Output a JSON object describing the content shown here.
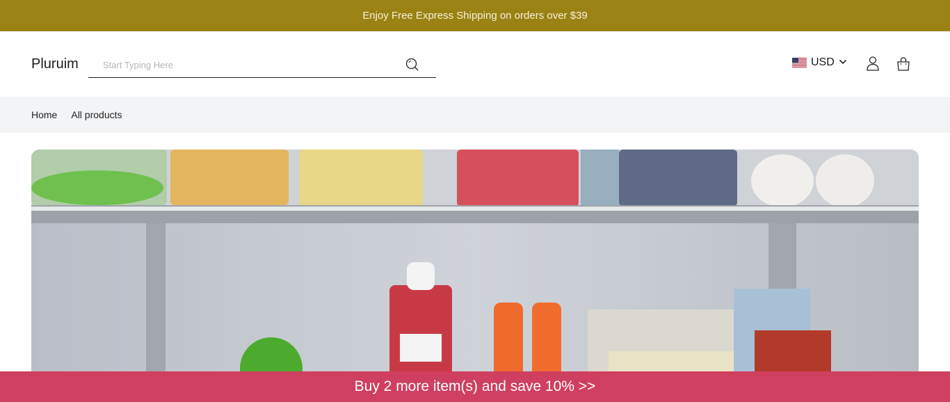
{
  "announcement": {
    "text": "Enjoy Free Express Shipping on orders over $39"
  },
  "header": {
    "logo": "Pluruim",
    "search": {
      "placeholder": "Start Typing Here",
      "value": ""
    },
    "currency": {
      "code": "USD",
      "flag": "us-flag-icon"
    }
  },
  "breadcrumb": {
    "items": [
      "Home",
      "All products"
    ]
  },
  "hero": {
    "alt": "refrigerator-shelves-image"
  },
  "promo": {
    "text": "Buy 2 more item(s) and save 10%  >>"
  },
  "colors": {
    "announcement_bg": "#9a8214",
    "promo_bg": "#cf3f5f",
    "breadcrumb_bg": "#f3f4f6"
  }
}
